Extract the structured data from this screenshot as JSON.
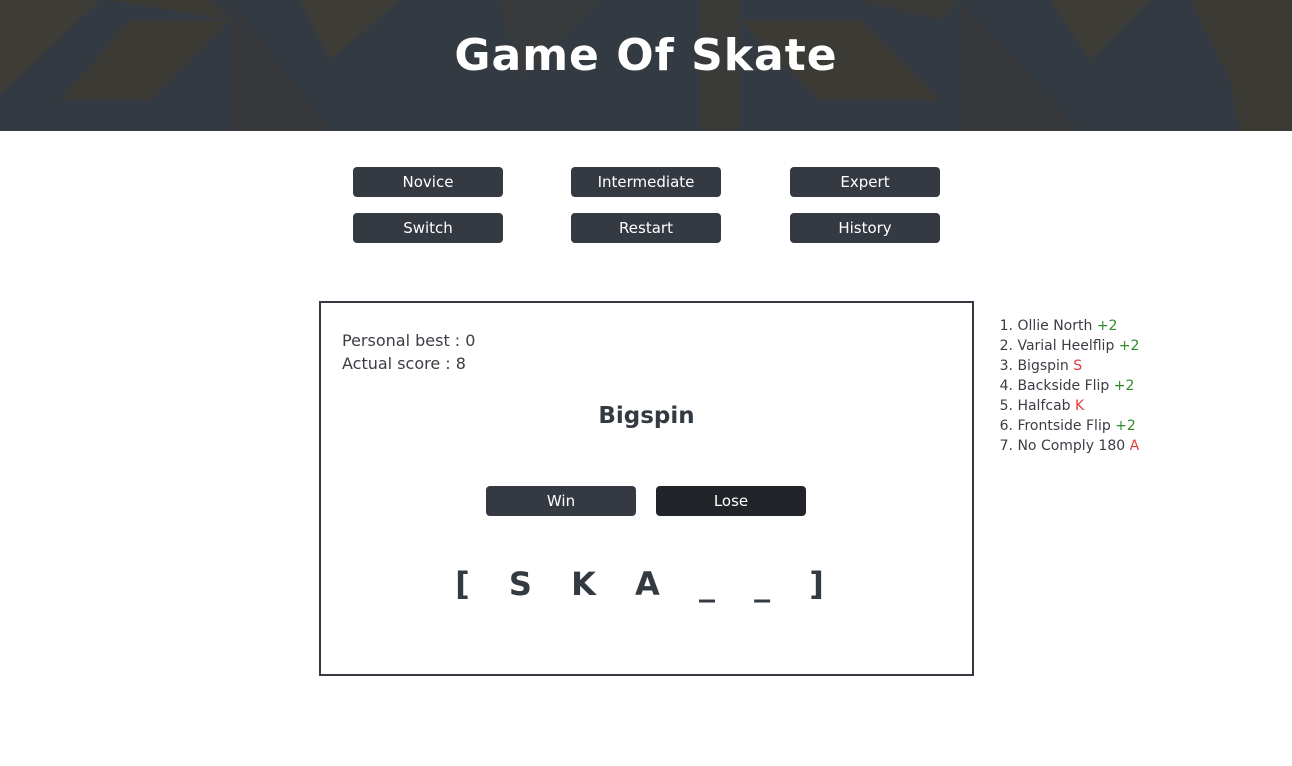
{
  "app": {
    "title": "Game Of Skate"
  },
  "colors": {
    "header_bg": "#343a41",
    "button_bg": "#353a42",
    "button_active_bg": "#212429",
    "win_mark": "#2e8b2e",
    "lose_mark": "#e23b3b"
  },
  "menu": {
    "novice_label": "Novice",
    "intermediate_label": "Intermediate",
    "expert_label": "Expert",
    "switch_label": "Switch",
    "restart_label": "Restart",
    "history_label": "History"
  },
  "game": {
    "personal_best_label": "Personal best : 0",
    "actual_score_label": "Actual score : 8",
    "current_trick": "Bigspin",
    "win_label": "Win",
    "lose_label": "Lose",
    "letters_display": "[ S K A _ _ ]"
  },
  "history": {
    "items": [
      {
        "num": "1.",
        "trick": "Ollie North",
        "result": "+2",
        "type": "plus"
      },
      {
        "num": "2.",
        "trick": "Varial Heelflip",
        "result": "+2",
        "type": "plus"
      },
      {
        "num": "3.",
        "trick": "Bigspin",
        "result": "S",
        "type": "letter"
      },
      {
        "num": "4.",
        "trick": "Backside Flip",
        "result": "+2",
        "type": "plus"
      },
      {
        "num": "5.",
        "trick": "Halfcab",
        "result": "K",
        "type": "letter"
      },
      {
        "num": "6.",
        "trick": "Frontside Flip",
        "result": "+2",
        "type": "plus"
      },
      {
        "num": "7.",
        "trick": "No Comply 180",
        "result": "A",
        "type": "letter"
      }
    ]
  }
}
